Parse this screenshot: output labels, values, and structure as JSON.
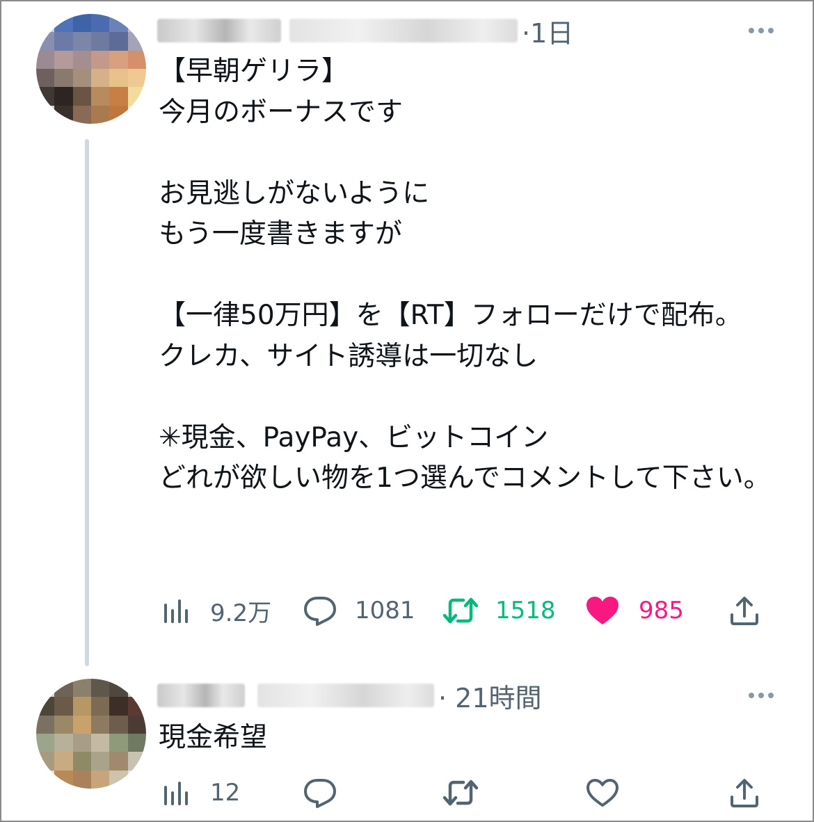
{
  "tweets": [
    {
      "time": "·1日",
      "text": "【早朝ゲリラ】\n今月のボーナスです\n\nお見逃しがないように\nもう一度書きますが\n\n【一律50万円】を【RT】フォローだけで配布。\nクレカ、サイト誘導は一切なし\n\n✳︎現金、PayPay、ビットコイン\nどれが欲しい物を1つ選んでコメントして下さい。",
      "views": "9.2万",
      "replies": "1081",
      "retweets": "1518",
      "likes": "985"
    },
    {
      "time": "· 21時間",
      "text": "現金希望",
      "views": "12",
      "replies": "",
      "retweets": "",
      "likes": ""
    }
  ],
  "icons": {
    "views": "bar-chart-icon",
    "reply": "speech-bubble-icon",
    "retweet": "retweet-arrows-icon",
    "like": "heart-icon",
    "share": "share-upload-icon",
    "more": "ellipsis-icon"
  },
  "colors": {
    "text": "#0f1419",
    "muted": "#536471",
    "retweet_active": "#00ba7c",
    "like_active": "#f91880",
    "thread_line": "#cfd9de"
  }
}
